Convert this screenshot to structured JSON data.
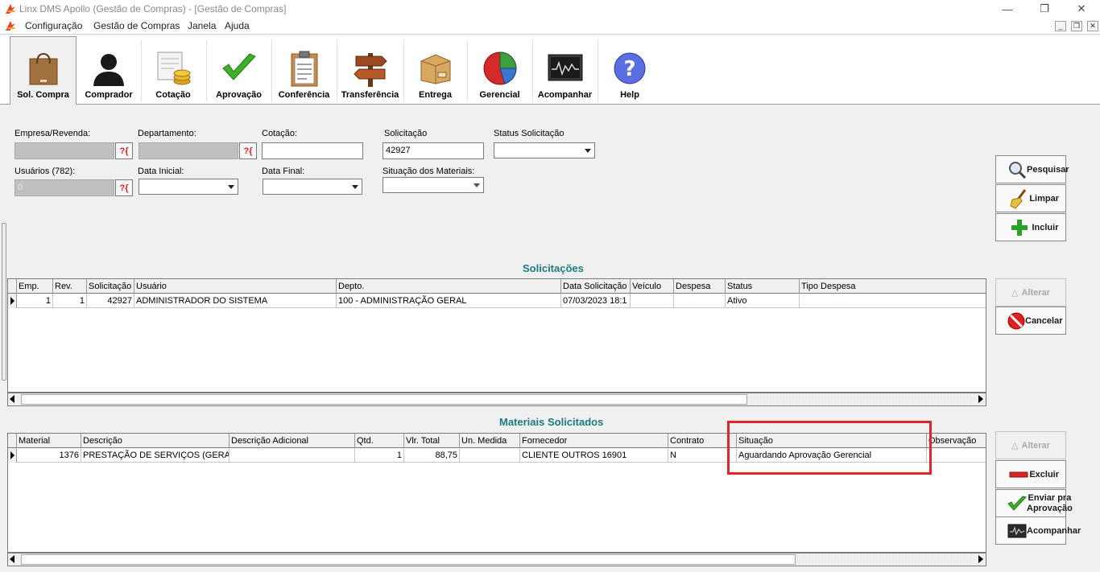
{
  "window": {
    "title": "Linx DMS Apollo (Gestão de Compras) - [Gestão de Compras]",
    "controls": {
      "minimize": "—",
      "restore": "❐",
      "close": "✕"
    }
  },
  "menu": {
    "items": [
      "Configuração",
      "Gestão de Compras",
      "Janela",
      "Ajuda"
    ]
  },
  "toolbar": {
    "buttons": [
      {
        "label": "Sol. Compra",
        "icon": "shopping-bag-icon"
      },
      {
        "label": "Comprador",
        "icon": "person-icon"
      },
      {
        "label": "Cotação",
        "icon": "coins-document-icon"
      },
      {
        "label": "Aprovação",
        "icon": "checkmark-icon"
      },
      {
        "label": "Conferência",
        "icon": "clipboard-icon"
      },
      {
        "label": "Transferência",
        "icon": "signpost-icon"
      },
      {
        "label": "Entrega",
        "icon": "box-icon"
      },
      {
        "label": "Gerencial",
        "icon": "pie-chart-icon"
      },
      {
        "label": "Acompanhar",
        "icon": "monitor-icon"
      },
      {
        "label": "Help",
        "icon": "help-icon"
      }
    ],
    "active": "Sol. Compra"
  },
  "form": {
    "empresa_label": "Empresa/Revenda:",
    "departamento_label": "Departamento:",
    "cotacao_label": "Cotação:",
    "solicitacao_label": "Solicitação",
    "solicitacao_value": "42927",
    "status_label": "Status Solicitação",
    "usuarios_label": "Usuários (782):",
    "usuarios_value": "0",
    "data_inicial_label": "Data Inicial:",
    "data_final_label": "Data Final:",
    "situacao_materiais_label": "Situação dos Materiais:",
    "lookup_text": "?{"
  },
  "side_buttons": {
    "pesquisar": "Pesquisar",
    "limpar": "Limpar",
    "incluir": "Incluir",
    "alterar": "Alterar",
    "cancelar": "Cancelar",
    "alterar2": "Alterar",
    "excluir": "Excluir",
    "enviar_line1": "Enviar pra",
    "enviar_line2": "Aprovação",
    "acompanhar": "Acompanhar"
  },
  "solicitacoes": {
    "title": "Solicitações",
    "columns": [
      "Emp.",
      "Rev.",
      "Solicitação",
      "Usuário",
      "Depto.",
      "Data Solicitação",
      "Veículo",
      "Despesa",
      "Status",
      "Tipo Despesa"
    ],
    "rows": [
      [
        "1",
        "1",
        "42927",
        "ADMINISTRADOR DO SISTEMA",
        "100 - ADMINISTRAÇÃO GERAL",
        "07/03/2023 18:1",
        "",
        "",
        "Ativo",
        ""
      ]
    ]
  },
  "materiais": {
    "title": "Materiais Solicitados",
    "columns": [
      "Material",
      "Descrição",
      "Descrição Adicional",
      "Qtd.",
      "Vlr. Total",
      "Un. Medida",
      "Fornecedor",
      "Contrato",
      "Situação",
      "Observação"
    ],
    "rows": [
      [
        "1376",
        "PRESTAÇÃO DE SERVIÇOS (GERAL)",
        "",
        "1",
        "88,75",
        "",
        "CLIENTE OUTROS 16901",
        "N",
        "Aguardando Aprovação Gerencial",
        ""
      ]
    ]
  },
  "colors": {
    "accent_title": "#1a7c80",
    "highlight": "#e0262b"
  }
}
